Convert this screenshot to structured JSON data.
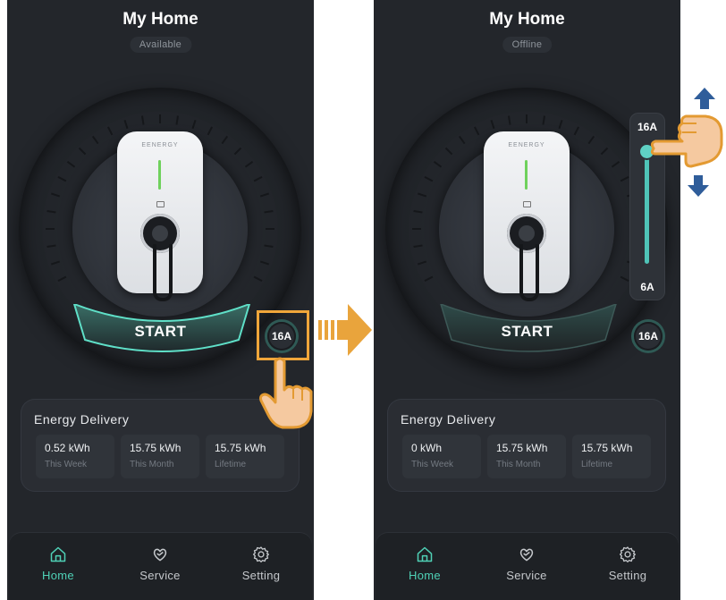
{
  "left": {
    "title": "My Home",
    "status": "Available",
    "brand": "EENERGY",
    "start": "START",
    "current": "16A",
    "energy": {
      "title": "Energy Delivery",
      "stats": [
        {
          "value": "0.52 kWh",
          "label": "This Week"
        },
        {
          "value": "15.75 kWh",
          "label": "This Month"
        },
        {
          "value": "15.75 kWh",
          "label": "Lifetime"
        }
      ]
    },
    "nav": [
      {
        "label": "Home",
        "icon": "home-icon",
        "active": true
      },
      {
        "label": "Service",
        "icon": "service-icon",
        "active": false
      },
      {
        "label": "Setting",
        "icon": "gear-icon",
        "active": false
      }
    ]
  },
  "right": {
    "title": "My Home",
    "status": "Offline",
    "brand": "EENERGY",
    "start": "START",
    "current": "16A",
    "slider": {
      "max_label": "16A",
      "min_label": "6A",
      "value_fraction": 1.0
    },
    "energy": {
      "title": "Energy Delivery",
      "stats": [
        {
          "value": "0 kWh",
          "label": "This Week"
        },
        {
          "value": "15.75 kWh",
          "label": "This Month"
        },
        {
          "value": "15.75 kWh",
          "label": "Lifetime"
        }
      ]
    },
    "nav": [
      {
        "label": "Home",
        "icon": "home-icon",
        "active": true
      },
      {
        "label": "Service",
        "icon": "service-icon",
        "active": false
      },
      {
        "label": "Setting",
        "icon": "gear-icon",
        "active": false
      }
    ]
  },
  "colors": {
    "accent": "#4fd1b6",
    "highlight": "#f0a63a",
    "hand": "#f5c9a0"
  }
}
